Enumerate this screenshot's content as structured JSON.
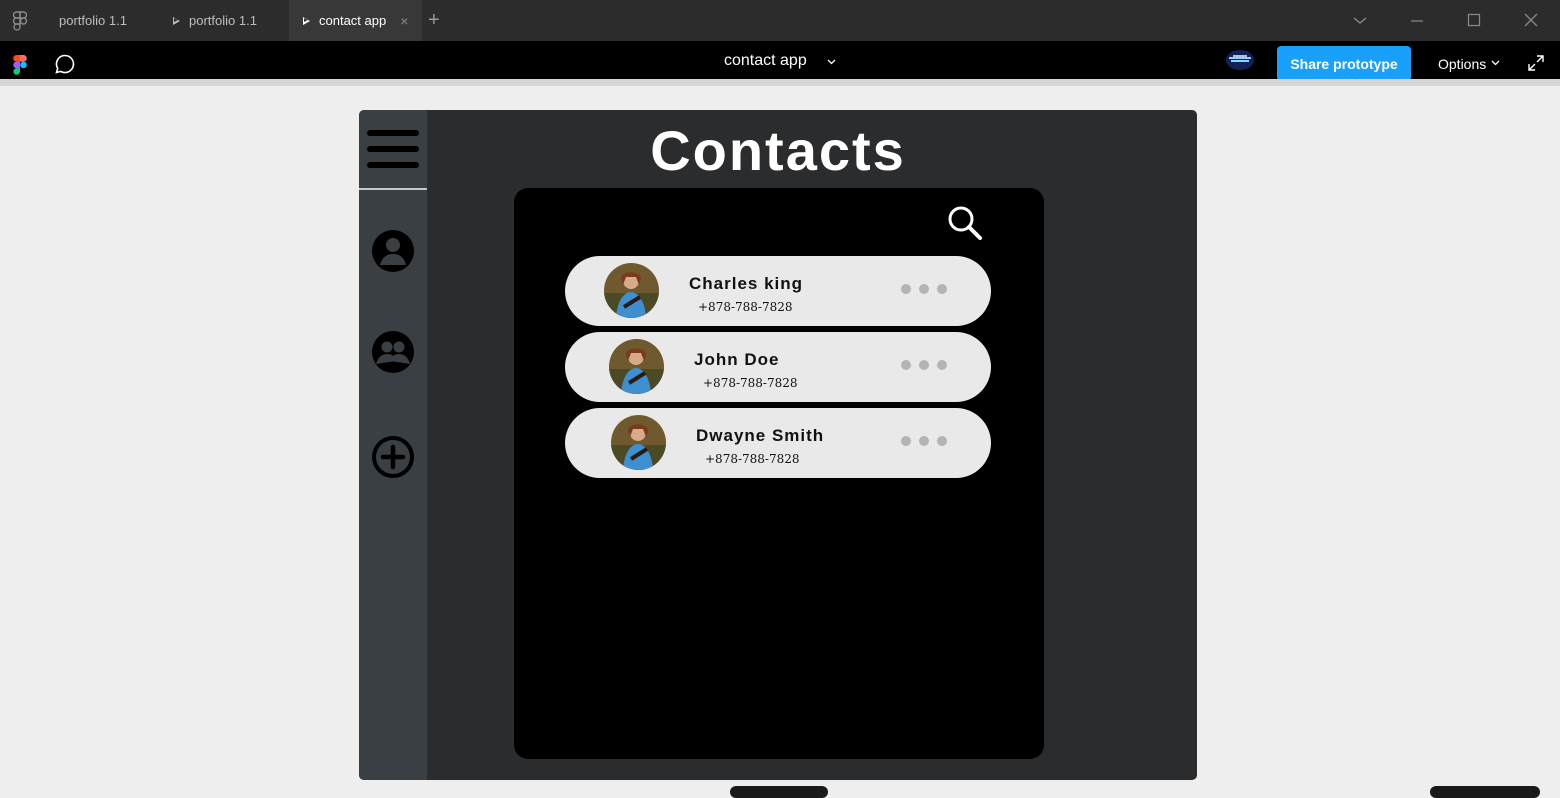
{
  "tabs": [
    {
      "label": "portfolio 1.1",
      "play": false,
      "active": false
    },
    {
      "label": "portfolio 1.1",
      "play": true,
      "active": false
    },
    {
      "label": "contact app",
      "play": true,
      "active": true
    }
  ],
  "tab_close_glyph": "×",
  "new_tab_glyph": "+",
  "toolbar": {
    "prototype_title": "contact app",
    "share_label": "Share prototype",
    "options_label": "Options"
  },
  "colors": {
    "share_button": "#18a0fb",
    "frame_bg": "#2a2c2e",
    "sidebar_bg": "#3a3f44",
    "panel_bg": "#000000",
    "card_bg": "#e9e9e9"
  },
  "app": {
    "title": "Contacts",
    "sidebar_icons": [
      "user-icon",
      "group-icon",
      "add-circle-icon"
    ],
    "contacts": [
      {
        "name": "Charles king",
        "phone": "+878-788-7828"
      },
      {
        "name": "John Doe",
        "phone": "+878-788-7828"
      },
      {
        "name": "Dwayne Smith",
        "phone": "+878-788-7828"
      }
    ]
  }
}
